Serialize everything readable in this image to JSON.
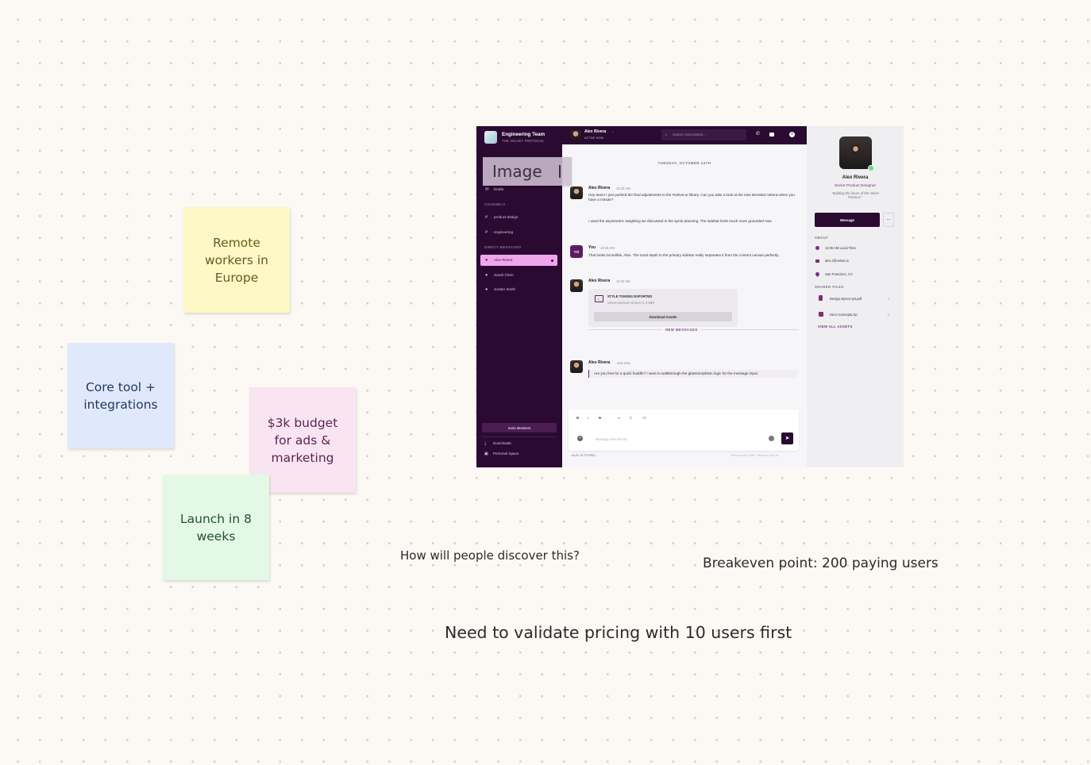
{
  "notes": {
    "remote": "Remote workers in Europe",
    "core": "Core tool + integrations",
    "budget": "$3k budget for ads & marketing",
    "launch": "Launch in 8 weeks"
  },
  "canvas_text": {
    "discover": "How will people discover this?",
    "breakeven": "Breakeven point: 200 paying users",
    "validate": "Need to validate pricing with 10 users first"
  },
  "image_label": "Image",
  "app": {
    "workspace": {
      "name": "Engineering Team",
      "subtitle": "THE VELVET PROTOCOL"
    },
    "sidebar": {
      "drafts": "Drafts",
      "channels_header": "CHANNELS",
      "channels": [
        "product-design",
        "engineering"
      ],
      "dm_header": "DIRECT MESSAGES",
      "dms": [
        "Alex Rivera",
        "Sarah Chen",
        "Jordan Smith"
      ],
      "invite": "Invite Members",
      "downloads": "Downloads",
      "personal_space": "Personal Space"
    },
    "topbar": {
      "name": "Alex Rivera",
      "status": "ACTIVE NOW",
      "search_placeholder": "Search conversation..."
    },
    "chat": {
      "date": "TUESDAY, OCTOBER 24TH",
      "new_messages": "NEW MESSAGES",
      "messages": [
        {
          "author": "Alex Rivera",
          "time": "10:24 AM",
          "text": "Hey team! I just pushed the final adjustments to the #velvet-ui library. Can you take a look at the new elevation tokens when you have a minute?"
        },
        {
          "author": "",
          "time": "",
          "text": "I used the asymmetric weighting we discussed in the sprint planning. The sidebar feels much more grounded now."
        },
        {
          "author": "You",
          "time": "10:45 AM",
          "text": "That looks incredible, Alex. The tonal depth in the primary sidebar really separates it from the content canvas perfectly."
        },
        {
          "author": "Alex Rivera",
          "time": "11:02 AM",
          "text": ""
        },
        {
          "author": "Alex Rivera",
          "time": "Just now",
          "text": "Are you free for a quick huddle? I want to walkthrough the glassmorphism logic for the message input."
        }
      ],
      "you_initials": "YO",
      "attachment": {
        "title": "STYLE TOKENS EXPORTED",
        "file": "velvet-protocol-v2.json (1.2 MB)",
        "button": "Download Assets"
      },
      "composer_placeholder": "Message Alex Rivera",
      "typing": "ALEX IS TYPING...",
      "hint": "Return to send, Shift + Return for new line"
    },
    "profile": {
      "name": "Alex Rivera",
      "role": "Senior Product Designer",
      "quote": "\"Building the future of the Velvet Protocol.\"",
      "message_button": "Message",
      "more": "···",
      "about_header": "ABOUT",
      "local_time": "11:05 AM Local Time",
      "email": "alex.r@velvet.io",
      "location": "San Francisco, CA",
      "files_header": "SHARED FILES",
      "files": [
        "Design-Specs-Q4.pdf",
        "Hero-Concepts.zip"
      ],
      "view_all": "VIEW ALL ASSETS"
    }
  },
  "colors": {
    "sidebar": "#2b0a32",
    "accent": "#5c1f5e",
    "active_dm": "#f0a6ef",
    "note_yellow": "#fdf8c6",
    "note_blue": "#dfe9fb",
    "note_pink": "#f9e5f2",
    "note_green": "#e3f9e5"
  }
}
